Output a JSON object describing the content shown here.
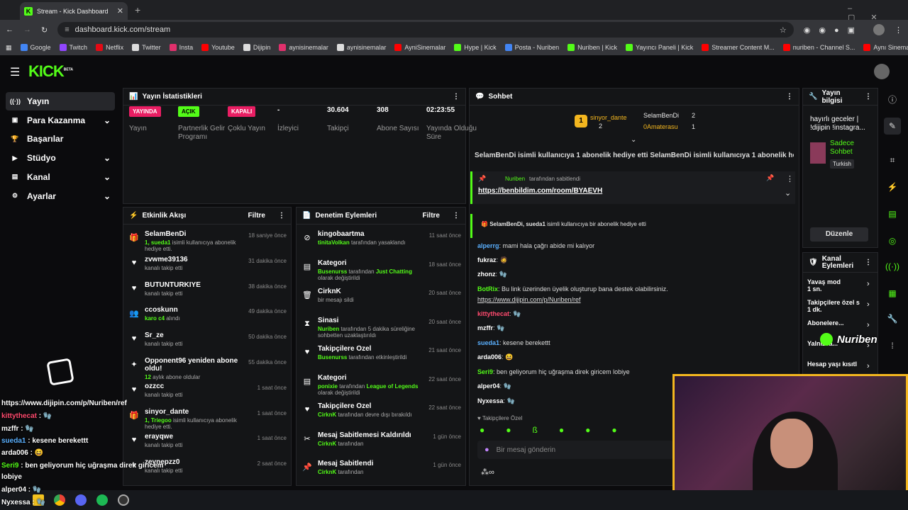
{
  "browser": {
    "tab_title": "Stream - Kick Dashboard",
    "url": "dashboard.kick.com/stream",
    "bookmarks": [
      {
        "label": "Google",
        "color": "#4285f4"
      },
      {
        "label": "Twitch",
        "color": "#9146ff"
      },
      {
        "label": "Netflix",
        "color": "#e50914"
      },
      {
        "label": "Twitter",
        "color": "#dddddd"
      },
      {
        "label": "Insta",
        "color": "#e1306c"
      },
      {
        "label": "Youtube",
        "color": "#ff0000"
      },
      {
        "label": "Dijipin",
        "color": "#dddddd"
      },
      {
        "label": "aynisinemalar",
        "color": "#e1306c"
      },
      {
        "label": "aynisinemalar",
        "color": "#dddddd"
      },
      {
        "label": "AyniSinemalar",
        "color": "#ff0000"
      },
      {
        "label": "Hype | Kick",
        "color": "#53fc18"
      },
      {
        "label": "Posta - Nuriben",
        "color": "#4285f4"
      },
      {
        "label": "Nuriben | Kick",
        "color": "#53fc18"
      },
      {
        "label": "Yayıncı Paneli | Kick",
        "color": "#53fc18"
      },
      {
        "label": "Streamer Content M...",
        "color": "#ff0000"
      },
      {
        "label": "nuriben - Channel S...",
        "color": "#ff0000"
      },
      {
        "label": "Aynı Sinemalar - Ça...",
        "color": "#ff0000"
      }
    ]
  },
  "logo": "KICK",
  "logo_sup": "BETA",
  "sidebar": [
    {
      "label": "Yayın",
      "icon": "broadcast-icon",
      "chev": ""
    },
    {
      "label": "Para Kazanma",
      "icon": "money-icon",
      "chev": "⌄"
    },
    {
      "label": "Başarılar",
      "icon": "trophy-icon",
      "chev": ""
    },
    {
      "label": "Stüdyo",
      "icon": "video-icon",
      "chev": "⌄"
    },
    {
      "label": "Kanal",
      "icon": "channel-icon",
      "chev": "⌄"
    },
    {
      "label": "Ayarlar",
      "icon": "settings-icon",
      "chev": "⌄"
    }
  ],
  "stats": {
    "title": "Yayın İstatistikleri",
    "items": [
      {
        "value": "YAYINDA",
        "label": "Yayın",
        "badge": "#e91e63"
      },
      {
        "value": "AÇIK",
        "label": "Partnerlik Gelir Programı",
        "badge": "#53fc18"
      },
      {
        "value": "KAPALI",
        "label": "Çoklu Yayın",
        "badge": "#e91e63"
      },
      {
        "value": "-",
        "label": "İzleyici",
        "badge": ""
      },
      {
        "value": "30.604",
        "label": "Takipçi",
        "badge": ""
      },
      {
        "value": "308",
        "label": "Abone Sayısı",
        "badge": ""
      },
      {
        "value": "02:23:55",
        "label": "Yayında Olduğu Süre",
        "badge": ""
      }
    ]
  },
  "activity": {
    "title": "Etkinlik Akışı",
    "filter": "Filtre",
    "items": [
      {
        "name": "SelamBenDi",
        "text_html": "<span class='g'>1, sueda1</span> isimli kullanıcıya abonelik hediye etti.",
        "time": "18 saniye önce",
        "icon": "gift-icon"
      },
      {
        "name": "zvwme39136",
        "text_html": "kanalı takip etti",
        "time": "31 dakika önce",
        "icon": "heart-icon"
      },
      {
        "name": "BUTUNTURKIYE",
        "text_html": "kanalı takip etti",
        "time": "38 dakika önce",
        "icon": "heart-icon"
      },
      {
        "name": "ccoskunn",
        "text_html": "<span class='g'>karo c4</span> alındı",
        "time": "49 dakika önce",
        "icon": "users-icon"
      },
      {
        "name": "Sr_ze",
        "text_html": "kanalı takip etti",
        "time": "50 dakika önce",
        "icon": "heart-icon"
      },
      {
        "name": "Opponent96 yeniden abone oldu!",
        "text_html": "<span class='g'>12</span> aylık abone oldular",
        "time": "55 dakika önce",
        "icon": "sparkle-icon"
      },
      {
        "name": "ozzcc",
        "text_html": "kanalı takip etti",
        "time": "1 saat önce",
        "icon": "heart-icon"
      },
      {
        "name": "sinyor_dante",
        "text_html": "<span class='g'>1, Triegoo</span> isimli kullanıcıya abonelik hediye etti.",
        "time": "1 saat önce",
        "icon": "gift-icon"
      },
      {
        "name": "erayqwe",
        "text_html": "kanalı takip etti",
        "time": "1 saat önce",
        "icon": "heart-icon"
      },
      {
        "name": "zeynepzz0",
        "text_html": "kanalı takip etti",
        "time": "2 saat önce",
        "icon": "heart-icon"
      }
    ]
  },
  "moderation": {
    "title": "Denetim Eylemleri",
    "filter": "Filtre",
    "items": [
      {
        "name": "kingobaartma",
        "text_html": "<span class='g'>tinitaVolkan</span> tarafından yasaklandı",
        "time": "11 saat önce",
        "icon": "ban-icon"
      },
      {
        "name": "Kategori",
        "text_html": "<span class='g'>Busenurss</span> tarafından <span class='g'>Just Chatting</span> olarak değiştirildi",
        "time": "18 saat önce",
        "icon": "category-icon"
      },
      {
        "name": "CirknK",
        "text_html": "bir mesajı sildi",
        "time": "20 saat önce",
        "icon": "trash-icon"
      },
      {
        "name": "Sinasi",
        "text_html": "<span class='g'>Nuriben</span> tarafından 5 dakika süreliğine sohbetten uzaklaştırıldı",
        "time": "20 saat önce",
        "icon": "hourglass-icon"
      },
      {
        "name": "Takipçilere Özel",
        "text_html": "<span class='g'>Busenurss</span> tarafından etkinleştirildi",
        "time": "21 saat önce",
        "icon": "heart-icon"
      },
      {
        "name": "Kategori",
        "text_html": "<span class='g'>ponixie</span> tarafından <span class='g'>League of Legends</span> olarak değiştirildi",
        "time": "22 saat önce",
        "icon": "category-icon"
      },
      {
        "name": "Takipçilere Özel",
        "text_html": "<span class='g'>CirknK</span> tarafından devre dışı bırakıldı",
        "time": "22 saat önce",
        "icon": "heart-icon"
      },
      {
        "name": "Mesaj Sabitlemesi Kaldırıldı",
        "text_html": "<span class='g'>CirknK</span> tarafından",
        "time": "1 gün önce",
        "icon": "unpin-icon"
      },
      {
        "name": "Mesaj Sabitlendi",
        "text_html": "<span class='g'>CirknK</span> tarafından",
        "time": "1 gün önce",
        "icon": "pin-icon"
      }
    ]
  },
  "chat": {
    "title": "Sohbet",
    "leaders": [
      {
        "rank": "1",
        "name": "sinyor_dante",
        "count": "2"
      },
      {
        "name": "SelamBenDi",
        "count": "2"
      },
      {
        "name": "0Amaterasu",
        "count": "1"
      }
    ],
    "ticker": "SelamBenDi isimli kullanıcıya 1 abonelik hediye etti    SelamBenDi isimli kullanıcıya 1 abonelik hediye etti",
    "pinned_by": "Nuriben",
    "pinned_suffix": "tarafından sabitlendi",
    "pinned_link": "https://benbildim.com/room/BYAEVH",
    "gift_line_user": "SelamBenDi, sueda1",
    "gift_line_text": "isimli kullanıcıya bir abonelik hediye etti",
    "messages": [
      {
        "user": "alperrg",
        "color": "#5ab0ff",
        "text": "mami hala çağrı abide mi kalıyor"
      },
      {
        "user": "fukraz",
        "color": "#ffffff",
        "text": "🧔"
      },
      {
        "user": "zhonz",
        "color": "#ffffff",
        "text": "🧤"
      },
      {
        "user": "BotRix",
        "color": "#53fc18",
        "text": "Bu link üzerinden üyelik oluşturup bana destek olabilirsiniz."
      },
      {
        "user": "",
        "color": "#ddd",
        "text": "https://www.dijipin.com/p/Nuriben/ref"
      },
      {
        "user": "kittythecat",
        "color": "#ff4a6e",
        "text": "🧤"
      },
      {
        "user": "mzffr",
        "color": "#ffffff",
        "text": "🧤"
      },
      {
        "user": "sueda1",
        "color": "#5ab0ff",
        "text": "kesene berekettt"
      },
      {
        "user": "arda006",
        "color": "#ffffff",
        "text": "😆"
      },
      {
        "user": "Seri9",
        "color": "#53fc18",
        "text": "ben geliyorum hiç uğraşma direk giricem lobiye"
      },
      {
        "user": "alper04",
        "color": "#ffffff",
        "text": "🧤"
      },
      {
        "user": "Nyxessa",
        "color": "#ffffff",
        "text": "🧤"
      }
    ],
    "mode": "Takipçilere Özel",
    "input_placeholder": "Bir mesaj gönderin"
  },
  "info": {
    "title": "Yayın bilgisi",
    "stream_title": "hayırlı geceler | !dijipin !instagra...",
    "category": "Sadece Sohbet",
    "tag": "Turkish",
    "edit": "Düzenle"
  },
  "channel_actions": {
    "title": "Kanal Eylemleri",
    "items": [
      {
        "label": "Yavaş mod",
        "sub": "1 sn."
      },
      {
        "label": "Takipçilere özel s",
        "sub": "1 dk."
      },
      {
        "label": "Abonelere...",
        "sub": ""
      },
      {
        "label": "Yalnızca...",
        "sub": ""
      },
      {
        "label": "Hesap yaşı kısıtl",
        "sub": ""
      }
    ]
  },
  "overlay": {
    "webcam_name": "Nuriben",
    "chat": [
      {
        "user": "",
        "text": "https://www.dijipin.com/p/Nuriben/ref",
        "color": "#fff"
      },
      {
        "user": "kittythecat",
        "text": "🧤",
        "color": "#ff4a6e"
      },
      {
        "user": "mzffr",
        "text": "🧤",
        "color": "#fff"
      },
      {
        "user": "sueda1",
        "text": "kesene berekettt",
        "color": "#5ab0ff"
      },
      {
        "user": "arda006",
        "text": "😆",
        "color": "#fff"
      },
      {
        "user": "Seri9",
        "text": "ben geliyorum hiç uğraşma direk giricem",
        "color": "#53fc18"
      },
      {
        "user": "",
        "text": "lobiye",
        "color": "#fff"
      },
      {
        "user": "alper04",
        "text": "🧤",
        "color": "#fff"
      },
      {
        "user": "Nyxessa",
        "text": "🧤",
        "color": "#fff"
      }
    ]
  }
}
